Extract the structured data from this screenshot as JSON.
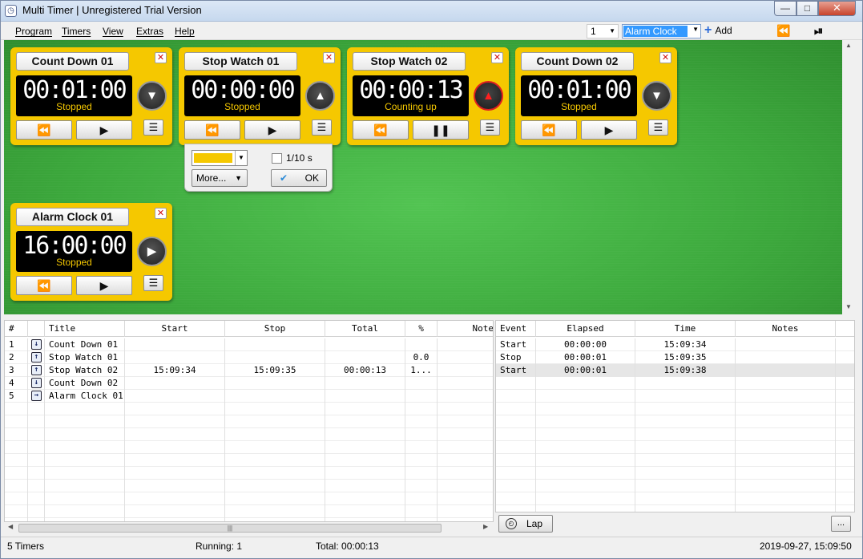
{
  "window": {
    "title": "Multi Timer | Unregistered Trial Version",
    "minimize": "—",
    "maximize": "□",
    "close": "✕"
  },
  "menu": {
    "items": [
      "Program",
      "Timers",
      "View",
      "Extras",
      "Help"
    ],
    "count_value": "1",
    "type_value": "Alarm Clock",
    "add_label": "Add",
    "rewind_icon": "⏪",
    "playpause_icon": "⏯"
  },
  "timers": [
    {
      "title": "Count Down 01",
      "time": "00:01:00",
      "status": "Stopped",
      "direction": "down",
      "dir_icon": "▼",
      "btn1": "⏪",
      "btn2": "▶"
    },
    {
      "title": "Stop Watch 01",
      "time": "00:00:00",
      "status": "Stopped",
      "direction": "up",
      "dir_icon": "▲",
      "btn1": "⏪",
      "btn2": "▶"
    },
    {
      "title": "Stop Watch 02",
      "time": "00:00:13",
      "status": "Counting up",
      "direction": "up-active",
      "dir_icon": "▲",
      "btn1": "⏪",
      "btn2": "❚❚"
    },
    {
      "title": "Count Down 02",
      "time": "00:01:00",
      "status": "Stopped",
      "direction": "down",
      "dir_icon": "▼",
      "btn1": "⏪",
      "btn2": "▶"
    },
    {
      "title": "Alarm Clock 01",
      "time": "16:00:00",
      "status": "Stopped",
      "direction": "play",
      "dir_icon": "▶",
      "btn1": "⏪",
      "btn2": "▶"
    }
  ],
  "card_close": "✕",
  "card_menu": "☰",
  "popup": {
    "color_value": "#f5c800",
    "tenth_label": "1/10 s",
    "tenth_checked": false,
    "more_label": "More...",
    "ok_label": "OK"
  },
  "timer_table": {
    "headers": [
      "#",
      "",
      "Title",
      "Start",
      "Stop",
      "Total",
      "%",
      "Note"
    ],
    "rows": [
      {
        "num": "1",
        "icon": "↓",
        "title": "Count Down 01",
        "start": "",
        "stop": "",
        "total": "",
        "pct": ""
      },
      {
        "num": "2",
        "icon": "↑",
        "title": "Stop Watch 01",
        "start": "",
        "stop": "",
        "total": "",
        "pct": "0.0"
      },
      {
        "num": "3",
        "icon": "↑",
        "title": "Stop Watch 02",
        "start": "15:09:34",
        "stop": "15:09:35",
        "total": "00:00:13",
        "pct": "1..."
      },
      {
        "num": "4",
        "icon": "↓",
        "title": "Count Down 02",
        "start": "",
        "stop": "",
        "total": "",
        "pct": ""
      },
      {
        "num": "5",
        "icon": "→",
        "title": "Alarm Clock 01",
        "start": "",
        "stop": "",
        "total": "",
        "pct": ""
      }
    ]
  },
  "event_table": {
    "headers": [
      "Event",
      "Elapsed",
      "Time",
      "Notes"
    ],
    "rows": [
      {
        "event": "Start",
        "elapsed": "00:00:00",
        "time": "15:09:34"
      },
      {
        "event": "Stop",
        "elapsed": "00:00:01",
        "time": "15:09:35"
      },
      {
        "event": "Start",
        "elapsed": "00:00:01",
        "time": "15:09:38"
      }
    ]
  },
  "lap_label": "Lap",
  "dots_label": "...",
  "scroll_thumb_grip": "|||",
  "status": {
    "timers": "5 Timers",
    "running": "Running: 1",
    "total": "Total: 00:00:13",
    "datetime": "2019-09-27, 15:09:50"
  }
}
